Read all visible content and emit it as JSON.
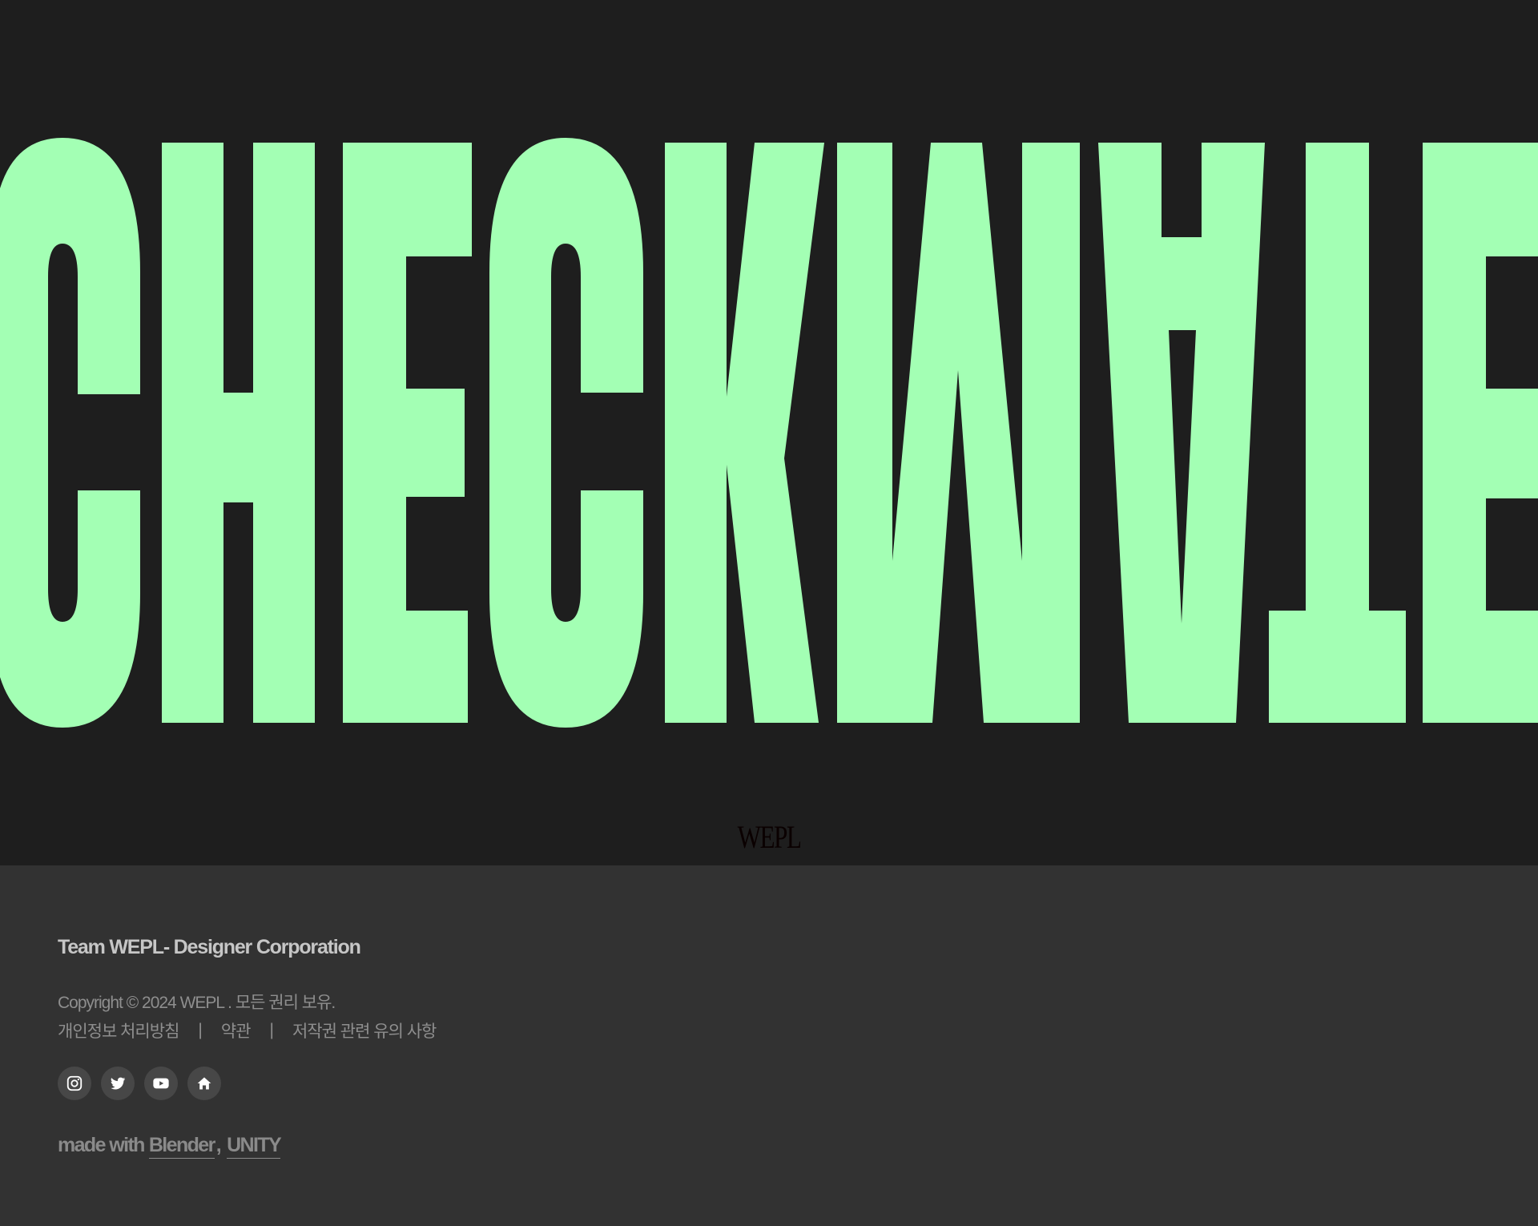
{
  "hero": {
    "banner_text": "CHECKWATE",
    "accent_color": "#a3ffb4",
    "background_color": "#1e1e1e"
  },
  "brand_mark": "WEPL",
  "footer": {
    "company": "Team WEPL- Designer Corporation",
    "copyright": "Copyright © 2024 WEPL . 모든 권리 보유.",
    "links": [
      {
        "label": "개인정보 처리방침"
      },
      {
        "label": "약관"
      },
      {
        "label": "저작권 관련 유의 사항"
      }
    ],
    "separator": "|",
    "socials": [
      {
        "icon": "instagram-icon"
      },
      {
        "icon": "twitter-icon"
      },
      {
        "icon": "youtube-icon"
      },
      {
        "icon": "home-icon"
      }
    ],
    "made_with": {
      "prefix": "made with",
      "tools": [
        "Blender",
        "UNITY"
      ],
      "joiner": ","
    },
    "background_color": "#323232"
  }
}
